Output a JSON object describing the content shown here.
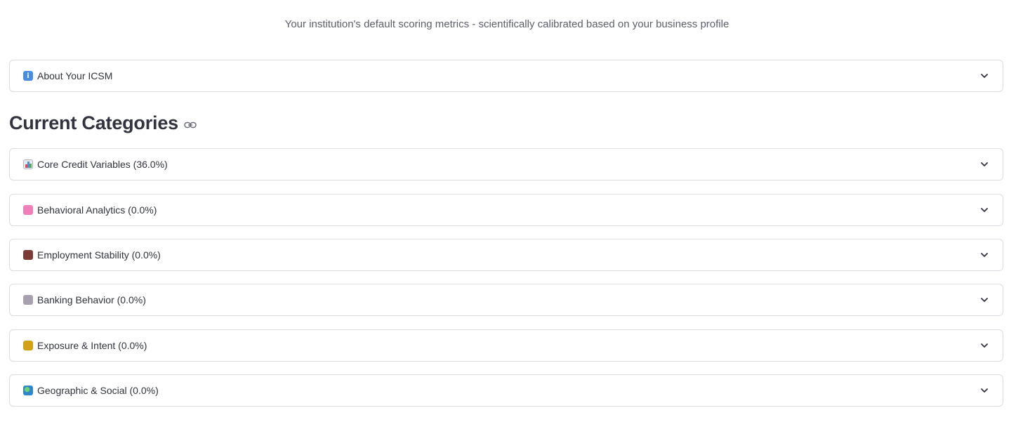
{
  "header": {
    "subtitle": "Your institution's default scoring metrics - scientifically calibrated based on your business profile"
  },
  "about": {
    "icon": "info-icon",
    "label": "About Your ICSM"
  },
  "section": {
    "title": "Current Categories",
    "anchor_icon": "link-icon"
  },
  "categories": [
    {
      "icon": "bar-chart-icon",
      "label": "Core Credit Variables (36.0%)"
    },
    {
      "icon": "brain-icon",
      "label": "Behavioral Analytics (0.0%)"
    },
    {
      "icon": "briefcase-icon",
      "label": "Employment Stability (0.0%)"
    },
    {
      "icon": "bank-icon",
      "label": "Banking Behavior (0.0%)"
    },
    {
      "icon": "money-bag-icon",
      "label": "Exposure & Intent (0.0%)"
    },
    {
      "icon": "globe-icon",
      "label": "Geographic & Social (0.0%)"
    }
  ],
  "colors": {
    "border": "#dcdde3",
    "text": "#31333f",
    "subtitle": "#5c5f6b"
  }
}
